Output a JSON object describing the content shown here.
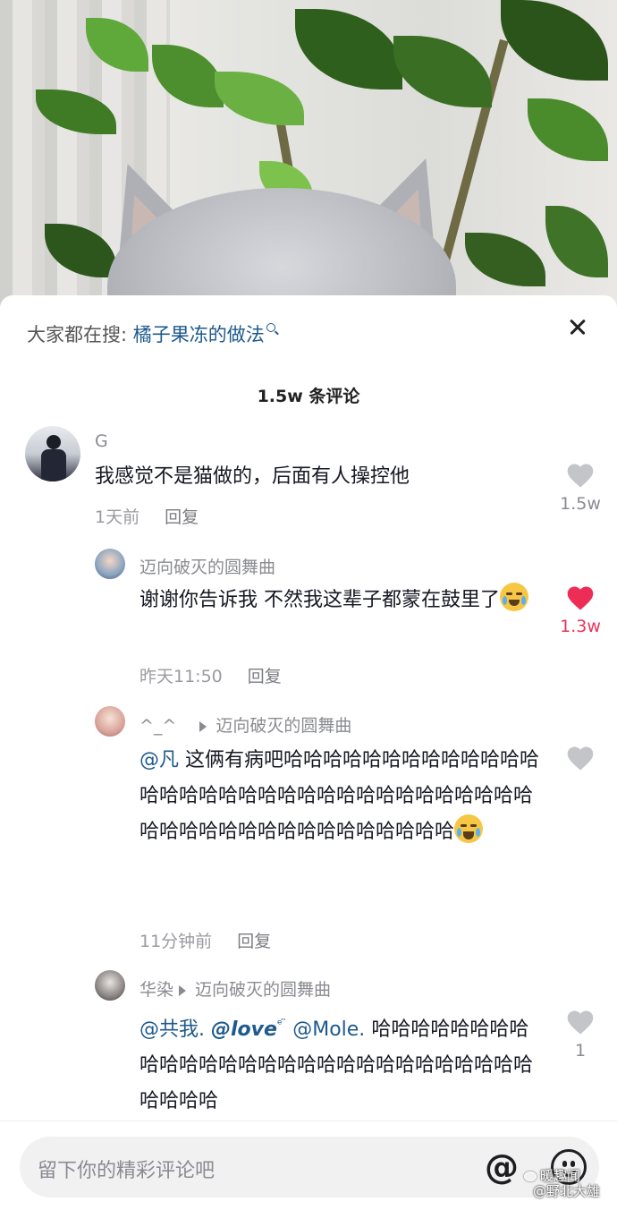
{
  "search_hint": {
    "prefix": "大家都在搜:",
    "term": "橘子果冻的做法"
  },
  "comment_count_title": "1.5w 条评论",
  "comments": [
    {
      "user": "G",
      "text": "我感觉不是猫做的，后面有人操控他",
      "time": "1天前",
      "reply_label": "回复",
      "likes": "1.5w",
      "liked": false
    },
    {
      "user": "迈向破灭的圆舞曲",
      "text": "谢谢你告诉我 不然我这辈子都蒙在鼓里了",
      "time": "昨天11:50",
      "reply_label": "回复",
      "likes": "1.3w",
      "liked": true
    },
    {
      "user": "^_^",
      "reply_to": "迈向破灭的圆舞曲",
      "mention": "@凡",
      "text": "这俩有病吧哈哈哈哈哈哈哈哈哈哈哈哈哈哈哈哈哈哈哈哈哈哈哈哈哈哈哈哈哈哈哈哈哈哈哈哈哈哈哈哈哈哈哈哈哈哈哈哈哈",
      "time": "11分钟前",
      "reply_label": "回复",
      "likes": "",
      "liked": false
    },
    {
      "user": "华染",
      "reply_to": "迈向破灭的圆舞曲",
      "mention1": "@共我.",
      "mention2": "@love",
      "mention2_sup": "ᵉ ̈",
      "mention3": "@Mole.",
      "text": "哈哈哈哈哈哈哈哈哈哈哈哈哈哈哈哈哈哈哈哈哈哈哈哈哈哈哈哈哈哈哈哈",
      "likes": "1",
      "liked": false
    }
  ],
  "input": {
    "placeholder": "留下你的精彩评论吧"
  },
  "watermark": {
    "line1": "暖趣闻",
    "line2": "@野北大雄"
  },
  "colors": {
    "link": "#1e5a8c",
    "like_active": "#e8345c",
    "muted": "#8a8b91"
  },
  "icons": [
    "close-icon",
    "search-small-icon",
    "heart-icon",
    "at-icon",
    "emoji-icon",
    "crying-emoji"
  ]
}
